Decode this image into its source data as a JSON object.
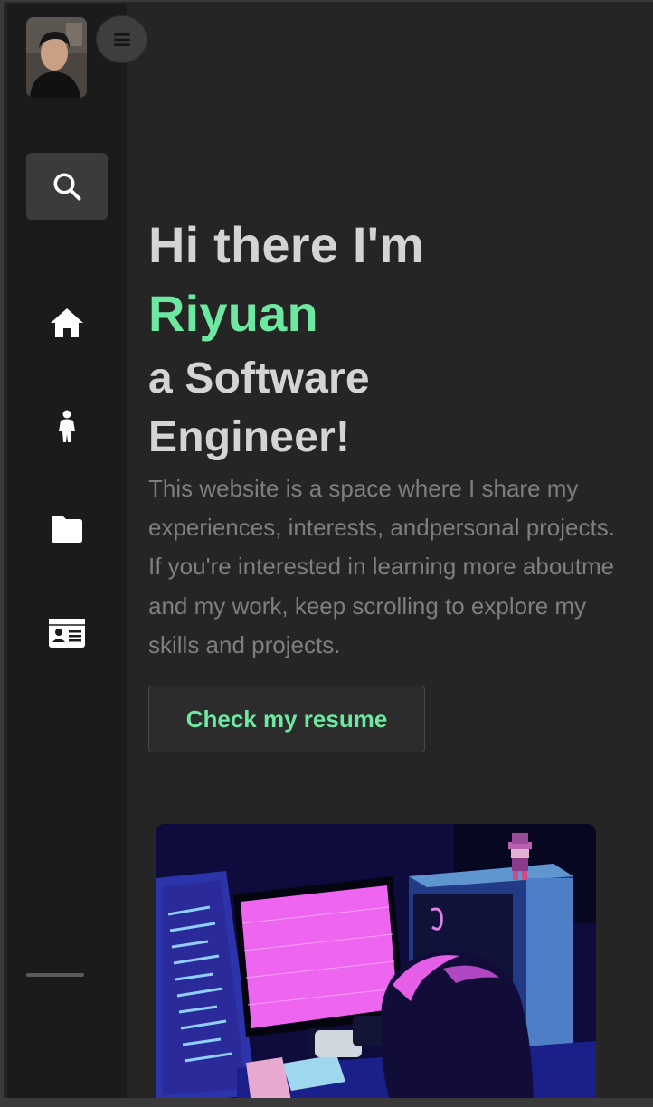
{
  "sidebar": {
    "avatar_alt": "Profile photo",
    "menu_icon": "hamburger-icon",
    "search_icon": "search-icon",
    "nav_items": [
      {
        "icon": "home-icon"
      },
      {
        "icon": "person-icon"
      },
      {
        "icon": "folder-icon"
      },
      {
        "icon": "contact-card-icon"
      }
    ]
  },
  "hero": {
    "line1": "Hi there I'm",
    "name": "Riyuan",
    "line3": "a Software",
    "line4": "Engineer!",
    "intro": "This website is a space where I share my experiences, interests, andpersonal projects. If you're interested in learning more aboutme and my work, keep scrolling to explore my skills and projects.",
    "resume_button": "Check my resume"
  },
  "colors": {
    "accent": "#6ee7a0",
    "background": "#252525",
    "sidebar": "#1b1b1b",
    "heading": "#d4d4d4",
    "body_text": "#7e7e7e"
  }
}
